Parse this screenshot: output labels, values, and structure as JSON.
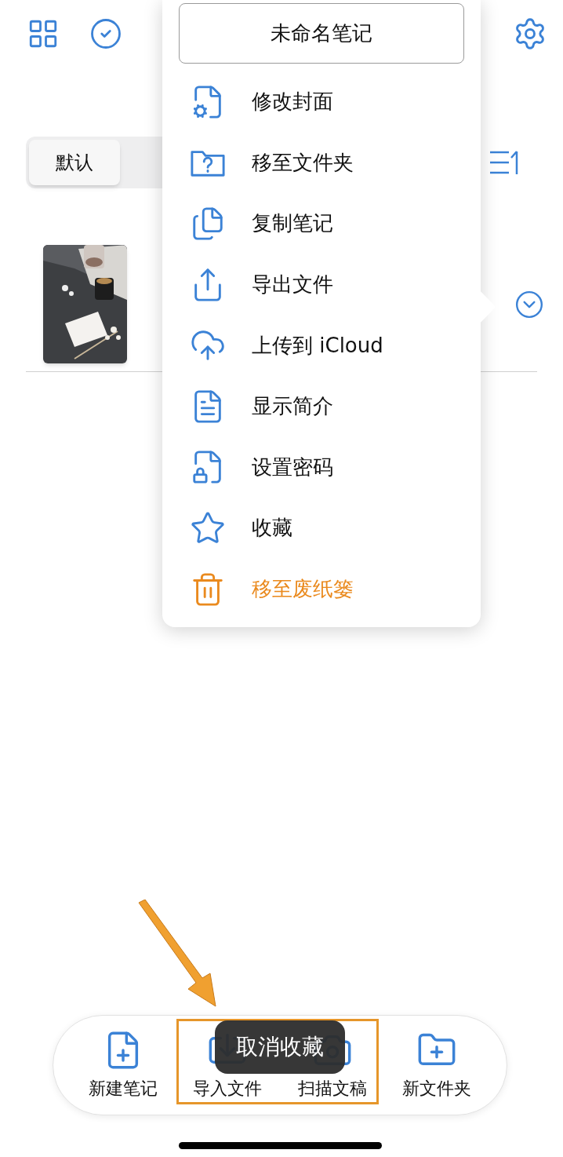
{
  "segments": [
    {
      "label": "默认",
      "selected": true
    }
  ],
  "menu": {
    "title": "未命名笔记",
    "items": [
      {
        "label": "修改封面",
        "kind": "normal"
      },
      {
        "label": "移至文件夹",
        "kind": "normal"
      },
      {
        "label": "复制笔记",
        "kind": "normal"
      },
      {
        "label": "导出文件",
        "kind": "normal"
      },
      {
        "label": "上传到 iCloud",
        "kind": "normal"
      },
      {
        "label": "显示简介",
        "kind": "normal"
      },
      {
        "label": "设置密码",
        "kind": "normal"
      },
      {
        "label": "收藏",
        "kind": "normal"
      },
      {
        "label": "移至废纸篓",
        "kind": "destructive"
      }
    ]
  },
  "toolbar": [
    {
      "label": "新建笔记"
    },
    {
      "label": "导入文件"
    },
    {
      "label": "扫描文稿"
    },
    {
      "label": "新文件夹"
    }
  ],
  "toast": "取消收藏"
}
